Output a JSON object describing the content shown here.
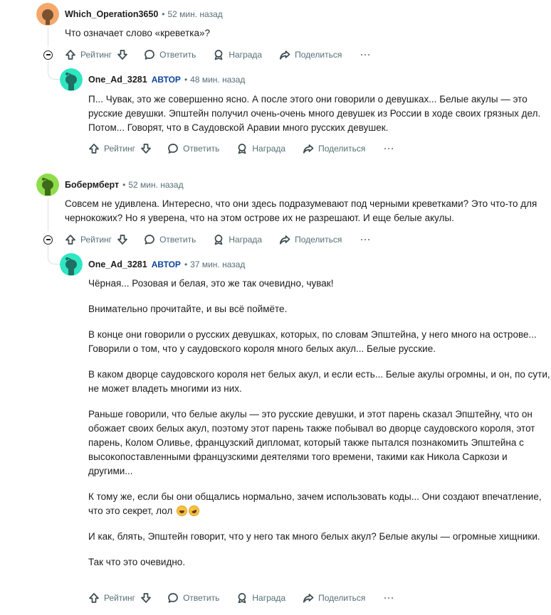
{
  "labels": {
    "rating": "Рейтинг",
    "reply": "Ответить",
    "award": "Награда",
    "share": "Поделиться",
    "more": "···",
    "op_badge": "АВТОР",
    "dot": "•"
  },
  "comments": [
    {
      "author": "Which_Operation3650",
      "time": "52 мин. назад",
      "avatar_color": "#f5a86b",
      "paragraphs": [
        "Что означает слово «креветка»?"
      ]
    },
    {
      "author": "One_Ad_3281",
      "time": "48 мин. назад",
      "avatar_color": "#2fe6c3",
      "is_op": true,
      "paragraphs": [
        "П... Чувак, это же совершенно ясно. А после этого они говорили о девушках... Белые акулы — это русские девушки. Эпштейн получил очень-очень много девушек из России в ходе своих грязных дел. Потом... Говорят, что в Саудовской Аравии много русских девушек."
      ]
    },
    {
      "author": "Бобермберт",
      "time": "52 мин. назад",
      "avatar_color": "#8fdc4b",
      "paragraphs": [
        "Совсем не удивлена. Интересно, что они здесь подразумевают под черными креветками? Это что-то для чернокожих? Но я уверена, что на этом острове их не разрешают. И еще белые акулы."
      ]
    },
    {
      "author": "One_Ad_3281",
      "time": "37 мин. назад",
      "avatar_color": "#2fe6c3",
      "is_op": true,
      "paragraphs": [
        "Чёрная... Розовая и белая, это же так очевидно, чувак!",
        "Внимательно прочитайте, и вы всё поймёте.",
        "В конце они говорили о русских девушках, которых, по словам Эпштейна, у него много на острове... Говорили о том, что у саудовского короля много белых акул... Белые русские.",
        "В каком дворце саудовского короля нет белых акул, и если есть... Белые акулы огромны, и он, по сути, не может владеть многими из них.",
        "Раньше говорили, что белые акулы — это русские девушки, и этот парень сказал Эпштейну, что он обожает своих белых акул, поэтому этот парень также побывал во дворце саудовского короля, этот парень, Колом Оливье, французский дипломат, который также пытался познакомить Эпштейна с высокопоставленными французскими деятелями того времени, такими как Никола Саркози и другими...",
        "К тому же, если бы они общались нормально, зачем использовать коды... Они создают впечатление, что это секрет, лол",
        "И как, блять, Эпштейн говорит, что у него так много белых акул? Белые акулы — огромные хищники.",
        "Так что это очевидно."
      ],
      "emoji_icons": [
        "grinning-squinting-face-icon",
        "rolling-laughing-face-icon"
      ]
    }
  ]
}
